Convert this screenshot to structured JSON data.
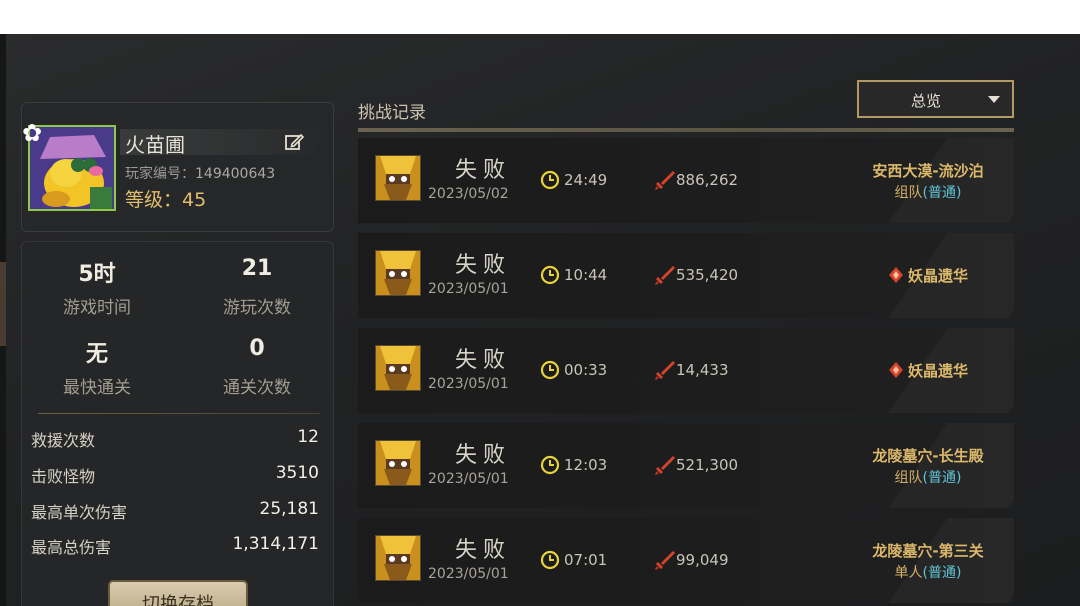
{
  "profile": {
    "name": "火苗圃",
    "id_label": "玩家编号：",
    "id_value": "149400643",
    "level_label": "等级：",
    "level_value": "45"
  },
  "stats": {
    "play_time_value": "5时",
    "play_time_label": "游戏时间",
    "play_count_value": "21",
    "play_count_label": "游玩次数",
    "fastest_value": "无",
    "fastest_label": "最快通关",
    "clear_count_value": "0",
    "clear_count_label": "通关次数",
    "rows": [
      {
        "label": "救援次数",
        "value": "12"
      },
      {
        "label": "击败怪物",
        "value": "3510"
      },
      {
        "label": "最高单次伤害",
        "value": "25,181"
      },
      {
        "label": "最高总伤害",
        "value": "1,314,171"
      }
    ],
    "switch_button": "切换存档"
  },
  "records_header": {
    "title": "挑战记录",
    "filter_selected": "总览"
  },
  "records": [
    {
      "result": "失败",
      "date": "2023/05/02",
      "time": "24:49",
      "damage": "886,262",
      "location": "安西大漠-流沙泊",
      "mode": "组队",
      "difficulty": "(普通)"
    },
    {
      "result": "失败",
      "date": "2023/05/01",
      "time": "10:44",
      "damage": "535,420",
      "location": "妖晶遗华",
      "mode": "",
      "difficulty": ""
    },
    {
      "result": "失败",
      "date": "2023/05/01",
      "time": "00:33",
      "damage": "14,433",
      "location": "妖晶遗华",
      "mode": "",
      "difficulty": ""
    },
    {
      "result": "失败",
      "date": "2023/05/01",
      "time": "12:03",
      "damage": "521,300",
      "location": "龙陵墓穴-长生殿",
      "mode": "组队",
      "difficulty": "(普通)"
    },
    {
      "result": "失败",
      "date": "2023/05/01",
      "time": "07:01",
      "damage": "99,049",
      "location": "龙陵墓穴-第三关",
      "mode": "单人",
      "difficulty": "(普通)"
    }
  ],
  "colors": {
    "accent_gold": "#e3bd6e",
    "difficulty_cyan": "#5fc4d6",
    "clock_yellow": "#e8d23a",
    "sword_red": "#d8432c"
  },
  "icons": [
    "edit-icon",
    "flower-icon",
    "clock-icon",
    "sword-icon",
    "crystal-icon",
    "chevron-down-icon"
  ]
}
